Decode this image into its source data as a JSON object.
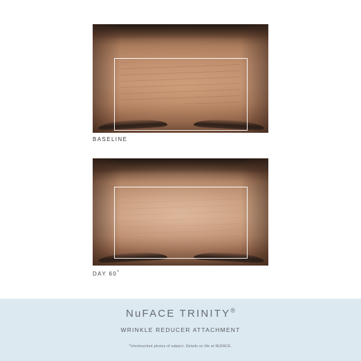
{
  "panels": [
    {
      "caption": "BASELINE"
    },
    {
      "caption": "DAY 60"
    }
  ],
  "caption_mark": "*",
  "footer": {
    "title": "NuFACE TRINITY",
    "title_mark": "®",
    "subtitle": "WRINKLE REDUCER ATTACHMENT",
    "note": "*Unretouched photos of subject. Details on file at NUFACE."
  },
  "colors": {
    "footer_background": "#dde9f0",
    "frame": "#ffffff",
    "text": "#3a3a3a"
  }
}
